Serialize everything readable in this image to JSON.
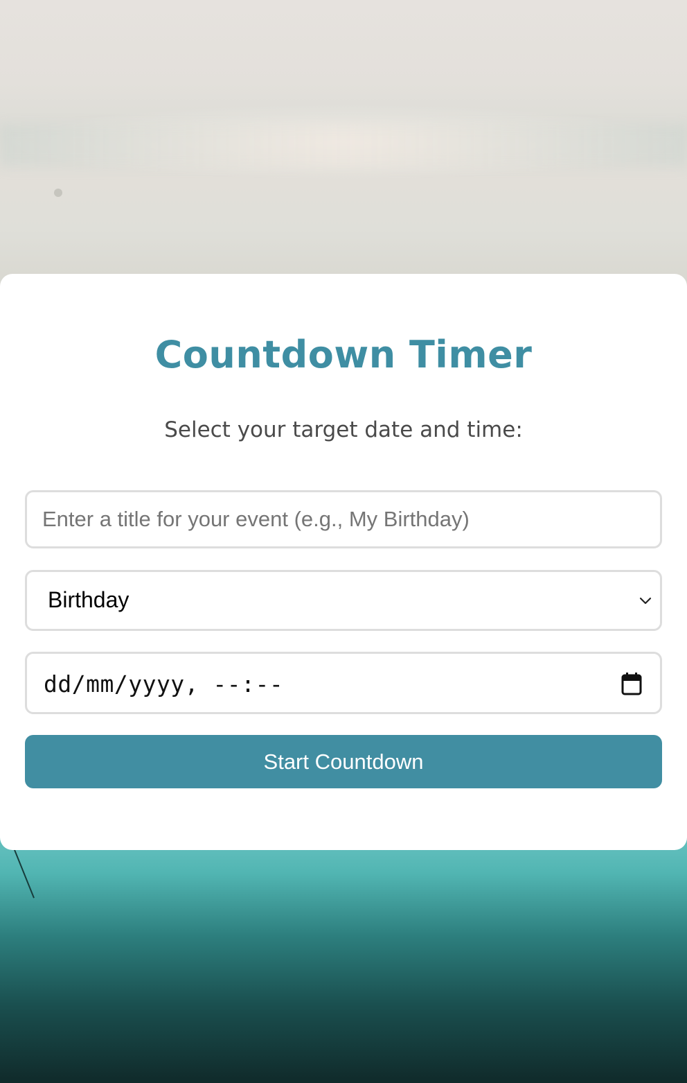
{
  "page": {
    "title": "Countdown Timer",
    "subtitle": "Select your target date and time:"
  },
  "form": {
    "event_title": {
      "value": "",
      "placeholder": "Enter a title for your event (e.g., My Birthday)"
    },
    "event_type": {
      "selected": "Birthday"
    },
    "datetime": {
      "display": "dd/mm/yyyy, --:--"
    },
    "start_button_label": "Start Countdown"
  },
  "colors": {
    "accent": "#418ea2",
    "title": "#3f8ea3",
    "field_border": "#dddddd"
  },
  "icons": {
    "select_arrow": "chevron-down-icon",
    "date_picker": "calendar-icon"
  }
}
